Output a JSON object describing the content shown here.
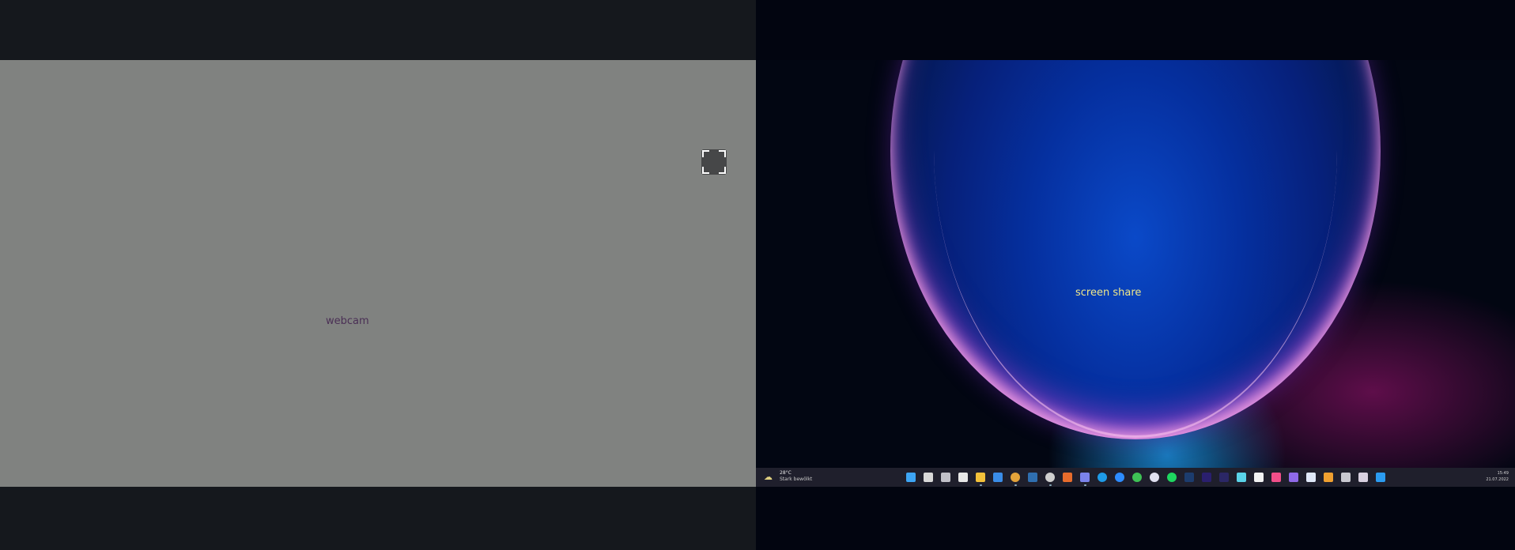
{
  "webcam": {
    "label": "webcam"
  },
  "screen_share": {
    "label": "screen share",
    "taskbar": {
      "weather": {
        "temperature": "28°C",
        "description": "Stark bewölkt",
        "icon": "cloud-sun-icon"
      },
      "clock": {
        "time": "15:49",
        "date": "21.07.2022"
      },
      "icons": [
        "windows-start-icon",
        "search-icon",
        "task-view-icon",
        "widgets-icon",
        "file-explorer-icon",
        "mail-icon",
        "chrome-icon",
        "app-l-icon",
        "chatgpt-icon",
        "calendar-icon",
        "teams-icon",
        "skype-icon",
        "zoom-icon",
        "whatsapp-icon",
        "messenger-icon",
        "spotify-icon",
        "photoshop-icon",
        "premiere-icon",
        "after-effects-icon",
        "notes-icon",
        "notion-icon",
        "jetbrains-icon",
        "obsidian-icon",
        "ndi-icon",
        "virtualbox-icon",
        "settings-icon",
        "network-icon",
        "vscode-icon"
      ]
    }
  },
  "colors": {
    "webcam_bg": "#808280",
    "webcam_label": "#4a2f55",
    "share_label": "#f0e88a",
    "taskbar_bg": "#1f1f2c"
  }
}
